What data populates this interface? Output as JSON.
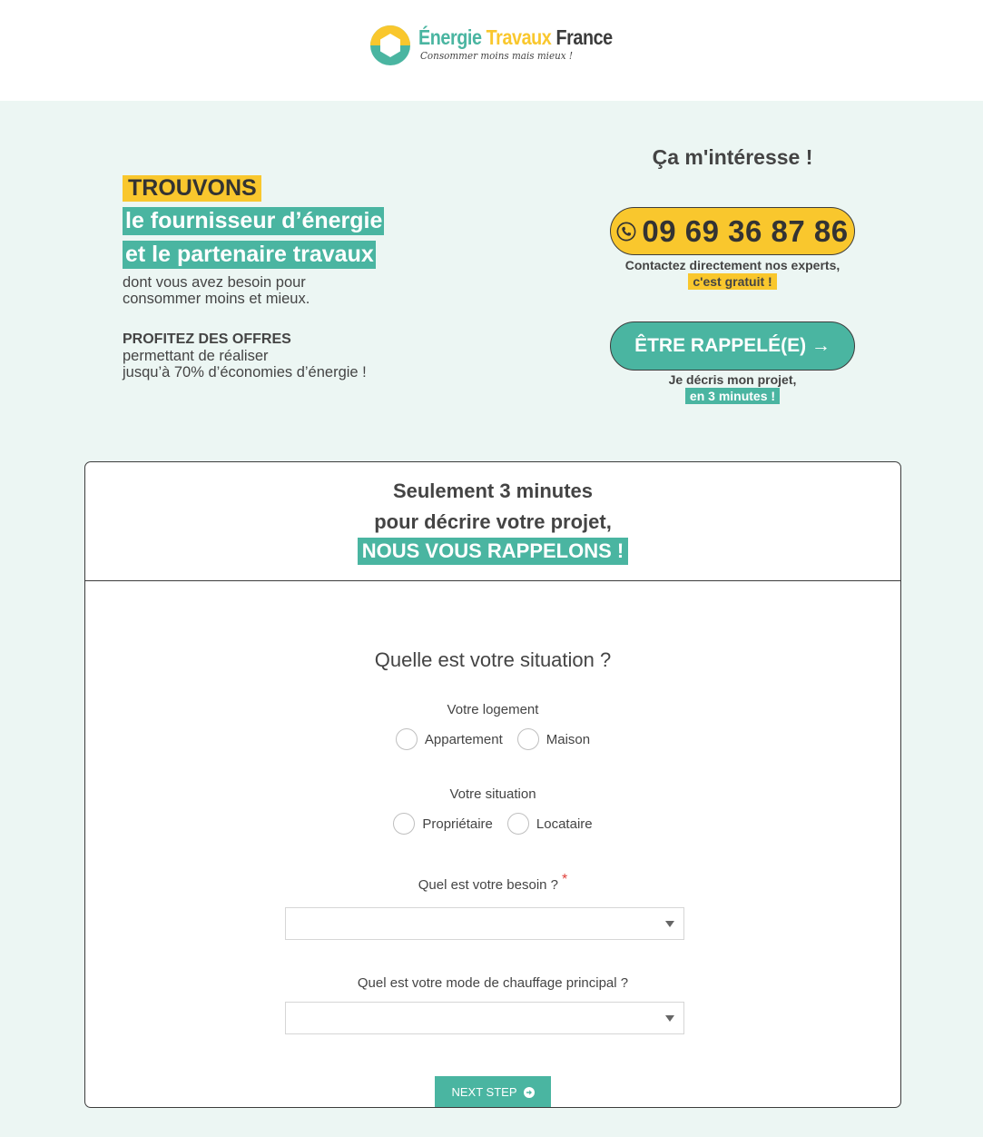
{
  "header": {
    "brand_word1": "Énergie",
    "brand_word2": "Travaux",
    "brand_word3": "France",
    "tagline": "Consommer moins mais mieux !"
  },
  "hero": {
    "highlight_yellow": "TROUVONS",
    "highlight_green_1": "le fournisseur d’énergie",
    "highlight_green_2": "et le partenaire travaux",
    "description_1": "dont vous avez besoin pour",
    "description_2": "consommer moins et mieux.",
    "offers_title": "PROFITEZ DES OFFRES",
    "offers_text_1": "permettant de réaliser",
    "offers_text_2": "jusqu’à 70% d’économies d’énergie !"
  },
  "cta": {
    "title": "Ça m'intéresse !",
    "phone_number": "09 69 36 87 86",
    "phone_caption": "Contactez directement nos experts,",
    "phone_caption_highlight": "c'est gratuit !",
    "callback_label": "ÊTRE RAPPELÉ(E) →",
    "callback_caption": "Je décris mon projet,",
    "callback_caption_highlight": "en 3 minutes !"
  },
  "form": {
    "header_line1": "Seulement 3 minutes",
    "header_line2": "pour décrire votre projet,",
    "header_highlight": "NOUS VOUS RAPPELONS !",
    "question_title": "Quelle est votre situation ?",
    "housing": {
      "label": "Votre logement",
      "options": [
        "Appartement",
        "Maison"
      ]
    },
    "situation": {
      "label": "Votre situation",
      "options": [
        "Propriétaire",
        "Locataire"
      ]
    },
    "need": {
      "label": "Quel est votre besoin ?",
      "required_mark": "*",
      "selected": ""
    },
    "heating": {
      "label": "Quel est votre mode de chauffage principal ?",
      "selected": ""
    },
    "next_button": "NEXT STEP"
  },
  "colors": {
    "teal": "#4ab5a1",
    "yellow": "#f9c72d",
    "background": "#ecf6f3",
    "text": "#444444",
    "required": "#e0403a"
  },
  "icons": [
    "logo-hexagon-icon",
    "phone-icon",
    "arrow-circle-right-icon",
    "caret-down-icon"
  ]
}
